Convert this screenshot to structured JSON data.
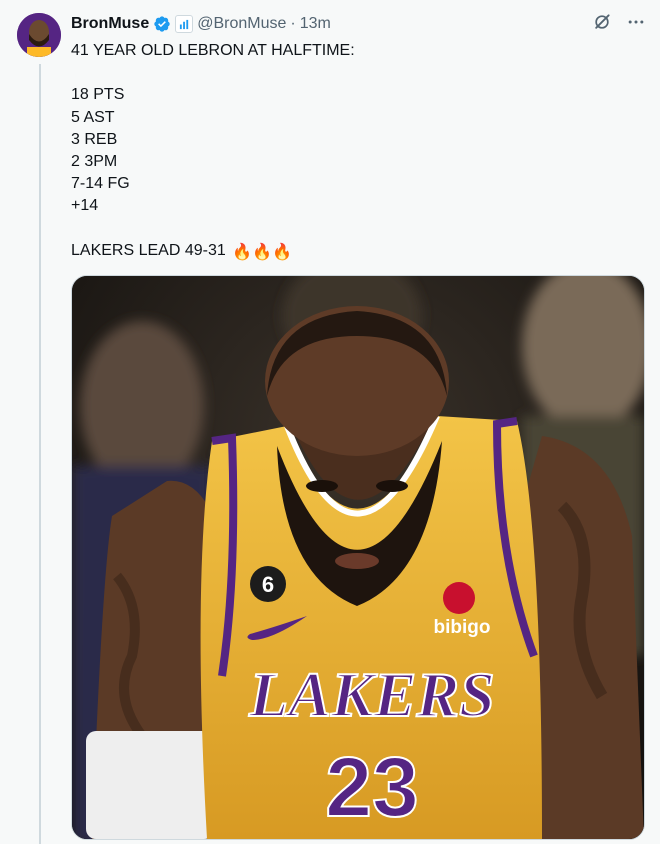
{
  "tweet": {
    "display_name": "BronMuse",
    "handle": "@BronMuse",
    "separator": "·",
    "time": "13m",
    "lines": [
      "41 YEAR OLD LEBRON AT HALFTIME:",
      "",
      "18 PTS",
      "5 AST",
      "3 REB",
      "2 3PM",
      "7-14 FG",
      "+14",
      "",
      "LAKERS LEAD 49-31"
    ],
    "emoji": "🔥🔥🔥"
  },
  "media": {
    "jersey_team": "LAKERS",
    "jersey_number": "23",
    "sponsor": "bibigo",
    "patch_number": "6"
  },
  "icons": {
    "verified": "verified-badge-icon",
    "affiliation": "affiliate-badge-icon",
    "grok": "grok-icon",
    "more": "more-icon"
  },
  "colors": {
    "verified_blue": "#1d9bf0",
    "lakers_gold": "#fdb927",
    "lakers_purple": "#552583",
    "muted_text": "#536471"
  }
}
